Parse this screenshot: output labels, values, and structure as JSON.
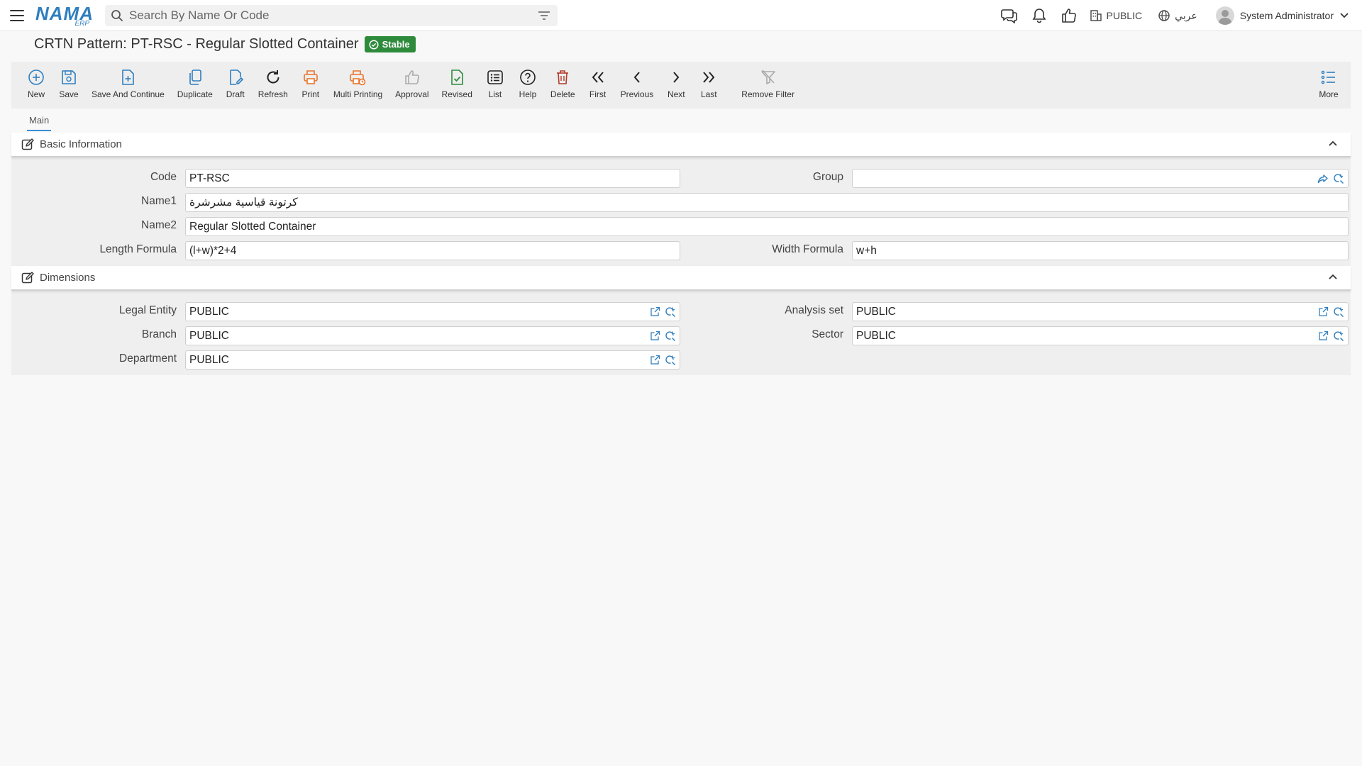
{
  "app": {
    "logo_text": "NAMA",
    "logo_sub": "ERP"
  },
  "search": {
    "placeholder": "Search By Name Or Code"
  },
  "header": {
    "company": "PUBLIC",
    "language": "عربي",
    "user": "System Administrator"
  },
  "page": {
    "title": "CRTN Pattern: PT-RSC - Regular Slotted Container",
    "status": "Stable"
  },
  "toolbar": {
    "new": "New",
    "save": "Save",
    "save_continue": "Save And Continue",
    "duplicate": "Duplicate",
    "draft": "Draft",
    "refresh": "Refresh",
    "print": "Print",
    "multi_printing": "Multi Printing",
    "approval": "Approval",
    "revised": "Revised",
    "list": "List",
    "help": "Help",
    "delete": "Delete",
    "first": "First",
    "previous": "Previous",
    "next": "Next",
    "last": "Last",
    "remove_filter": "Remove Filter",
    "more": "More"
  },
  "tabs": {
    "main": "Main"
  },
  "basic": {
    "title": "Basic Information",
    "code_label": "Code",
    "code": "PT-RSC",
    "group_label": "Group",
    "group": "",
    "name1_label": "Name1",
    "name1": "كرتونة قياسية مشرشرة",
    "name2_label": "Name2",
    "name2": "Regular Slotted Container",
    "length_label": "Length Formula",
    "length": "(l+w)*2+4",
    "width_label": "Width Formula",
    "width": "w+h"
  },
  "dimensions": {
    "title": "Dimensions",
    "legal_label": "Legal Entity",
    "legal": "PUBLIC",
    "analysis_label": "Analysis set",
    "analysis": "PUBLIC",
    "branch_label": "Branch",
    "branch": "PUBLIC",
    "sector_label": "Sector",
    "sector": "PUBLIC",
    "department_label": "Department",
    "department": "PUBLIC"
  },
  "colors": {
    "accent": "#2f7fbf",
    "stable": "#2e8b3c",
    "print": "#e8742a",
    "delete": "#b23b2b",
    "revised": "#2e8b3c"
  }
}
